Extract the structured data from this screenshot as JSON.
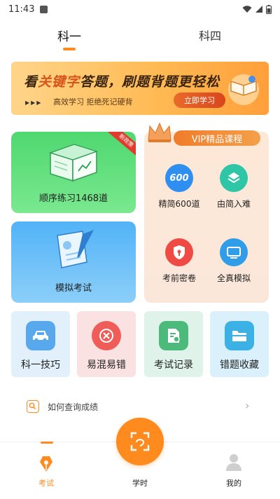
{
  "status": {
    "time": "11:43"
  },
  "tabs": [
    {
      "label": "科一",
      "active": true
    },
    {
      "label": "科四",
      "active": false
    }
  ],
  "banner": {
    "title_a": "看",
    "title_hl": "关键字",
    "title_b": "答题，刷题背题更轻松",
    "subtitle": "高效学习  拒绝死记硬背",
    "button": "立即学习",
    "arrows": "▶▶▶"
  },
  "practice": {
    "sequence": {
      "label": "顺序练习1468道",
      "badge": "新政策"
    },
    "mock": {
      "label": "模拟考试"
    }
  },
  "vip": {
    "title": "VIP精品课程",
    "items": [
      {
        "label": "精简600道",
        "icon_text": "600",
        "icon": "600-icon",
        "color": "#2e8ff0"
      },
      {
        "label": "由简入难",
        "icon": "layers-icon",
        "color": "#2ec6a6"
      },
      {
        "label": "考前密卷",
        "icon": "shield-lock-icon",
        "color": "#f04a45"
      },
      {
        "label": "全真模拟",
        "icon": "monitor-icon",
        "color": "#2f9de8"
      }
    ]
  },
  "tools": [
    {
      "label": "科一技巧",
      "icon": "car-icon",
      "bg": "#e1f0fb",
      "iconbg": "#58a8ee"
    },
    {
      "label": "易混易错",
      "icon": "close-icon",
      "bg": "#fbe2e2",
      "iconbg": "#f05c58"
    },
    {
      "label": "考试记录",
      "icon": "document-clock-icon",
      "bg": "#e0f3ea",
      "iconbg": "#4cba7a"
    },
    {
      "label": "错题收藏",
      "icon": "folder-icon",
      "bg": "#daf1fb",
      "iconbg": "#3cb1e6"
    }
  ],
  "query": {
    "text": "如何查询成绩"
  },
  "nav": [
    {
      "label": "考试",
      "icon": "pen-icon",
      "active": true
    },
    {
      "label": "学时",
      "icon": "scan-icon",
      "active": false
    },
    {
      "label": "我的",
      "icon": "user-icon",
      "active": false
    }
  ],
  "colors": {
    "accent": "#ff8a1e"
  }
}
